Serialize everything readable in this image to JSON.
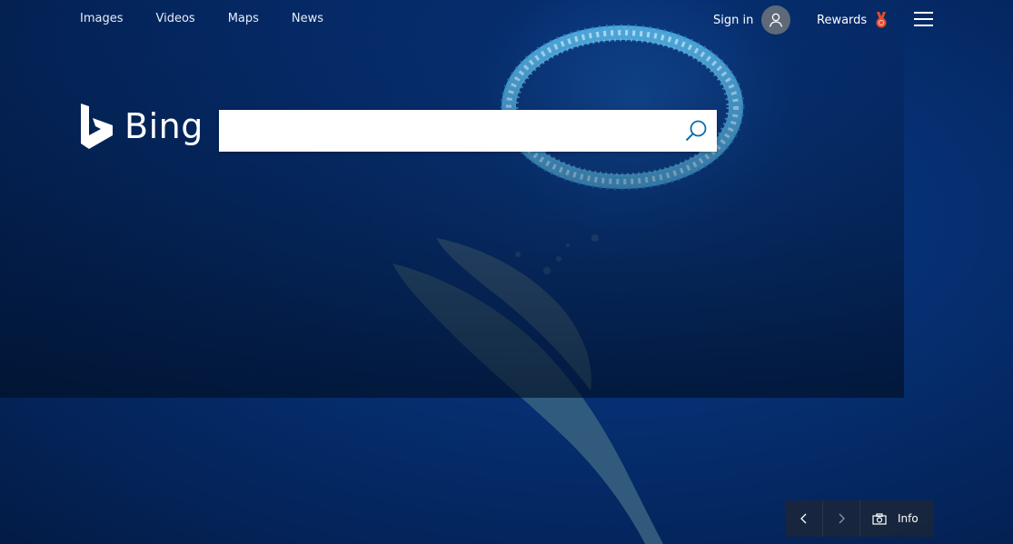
{
  "nav": {
    "links": [
      {
        "label": "Images"
      },
      {
        "label": "Videos"
      },
      {
        "label": "Maps"
      },
      {
        "label": "News"
      }
    ]
  },
  "account": {
    "sign_in_label": "Sign in",
    "avatar_icon": "user-icon"
  },
  "rewards": {
    "label": "Rewards",
    "icon": "medal-icon",
    "icon_color": "#e64a2e"
  },
  "logo": {
    "text": "Bing"
  },
  "search": {
    "value": "",
    "placeholder": "",
    "icon": "search-icon",
    "icon_color": "#0c6da5"
  },
  "controls": {
    "prev_icon": "chevron-left-icon",
    "next_icon": "chevron-right-icon",
    "camera_icon": "camera-icon",
    "info_label": "Info"
  }
}
